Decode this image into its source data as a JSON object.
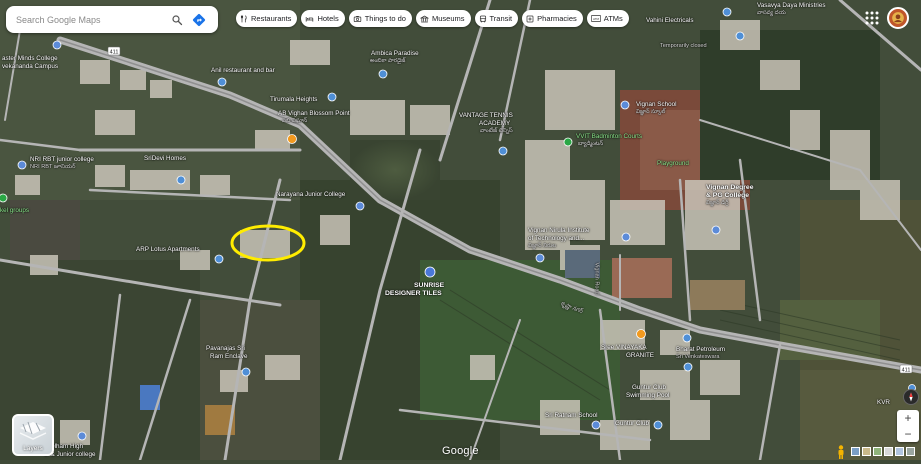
{
  "search": {
    "placeholder": "Search Google Maps"
  },
  "chips": [
    {
      "label": "Restaurants",
      "icon": "fork-knife-icon"
    },
    {
      "label": "Hotels",
      "icon": "bed-icon"
    },
    {
      "label": "Things to do",
      "icon": "camera-icon"
    },
    {
      "label": "Museums",
      "icon": "museum-icon"
    },
    {
      "label": "Transit",
      "icon": "bus-icon"
    },
    {
      "label": "Pharmacies",
      "icon": "pharmacy-icon"
    },
    {
      "label": "ATMs",
      "icon": "atm-icon"
    }
  ],
  "avatar": {
    "initial": ""
  },
  "layers": {
    "label": "Layers"
  },
  "logo": {
    "text": "Google"
  },
  "zoom": {
    "plus": "+",
    "minus": "−"
  },
  "road_shields": {
    "left": "411",
    "right": "411"
  },
  "places": {
    "master_minds_1": "aster Minds College",
    "master_minds_2": "vekananda Campus",
    "anil_restaurant": "Anil restaurant and bar",
    "ambica_paradise": "Ambica Paradise",
    "ambica_telugu": "అంబికా పారడైజ్",
    "tirumala_heights": "Tirumala Heights",
    "ab_vighan_1": "AB Vighan Blossom Point",
    "ab_vighan_2": "ఎబి విఘాన్",
    "vantage_tennis_1": "VANTAGE TENNIS",
    "vantage_tennis_2": "ACADEMY",
    "vantage_telugu": "వాంటేజ్ టెన్నిస్",
    "nri_rbt_1": "NRI RBT junior college",
    "nri_rbt_2": "NRI RBT జూనియర్",
    "sridevi_homes": "SriDevi Homes",
    "narayana_college": "Narayana Junior College",
    "arp_lotus": "ARP Lotus Apartments",
    "sunrise_1": "SUNRISE",
    "sunrise_2": "DESIGNER TILES",
    "vignan_nirula_1": "Vignan Nirula Institute",
    "vignan_nirula_2": "of Technology and...",
    "vignan_nirula_3": "విజ్ఞాన్ నిరుల",
    "vignan_school_1": "Vignan School",
    "vignan_school_2": "విజ్ఞాన్ స్కూల్",
    "vvit_badminton_1": "VVIT Badminton Courts",
    "vvit_badminton_2": "బ్యాడ్మింటన్",
    "playground": "Playground",
    "vignan_degree_1": "Vignan Degree",
    "vignan_degree_2": "& PG College",
    "vignan_degree_3": "విజ్ఞాన్ డిగ్రీ",
    "vahini_electricals": "Vahini Electricals",
    "temporarily_closed": "Temporarily closed",
    "vasavya_1": "Vasavya Daya Ministries",
    "vasavya_2": "వాసవ్య దయ",
    "pavanajas_1": "Pavanajas Sri",
    "pavanajas_2": "Ram Enclave",
    "sree_vinayaka_1": "Sree VINAYAKA",
    "sree_vinayaka_2": "GRANITE",
    "bharat_petroleum_1": "Bharat Petroleum",
    "bharat_petroleum_2": "Sri Venkateswara",
    "guntur_club_pool_1": "Guntur Club",
    "guntur_club_pool_2": "Swimming Pool",
    "sri_ratnam": "Sri Ratnam School",
    "guntur_club": "Guntur Club",
    "telham_1": "Telham High",
    "telham_2": "ol & Junior college",
    "kvr": "KVR",
    "kel_groups": "kel groups",
    "krishna_nagar": "కృష్ణా నగర్",
    "vertical_road": "Vignan Road"
  },
  "colors": {
    "highlight_ring": "#ffec00",
    "place_pin": "#4f8fd6",
    "food_pin": "#f29a1f",
    "school_pin": "#5c8bd8",
    "road": "#b5b5b5"
  }
}
